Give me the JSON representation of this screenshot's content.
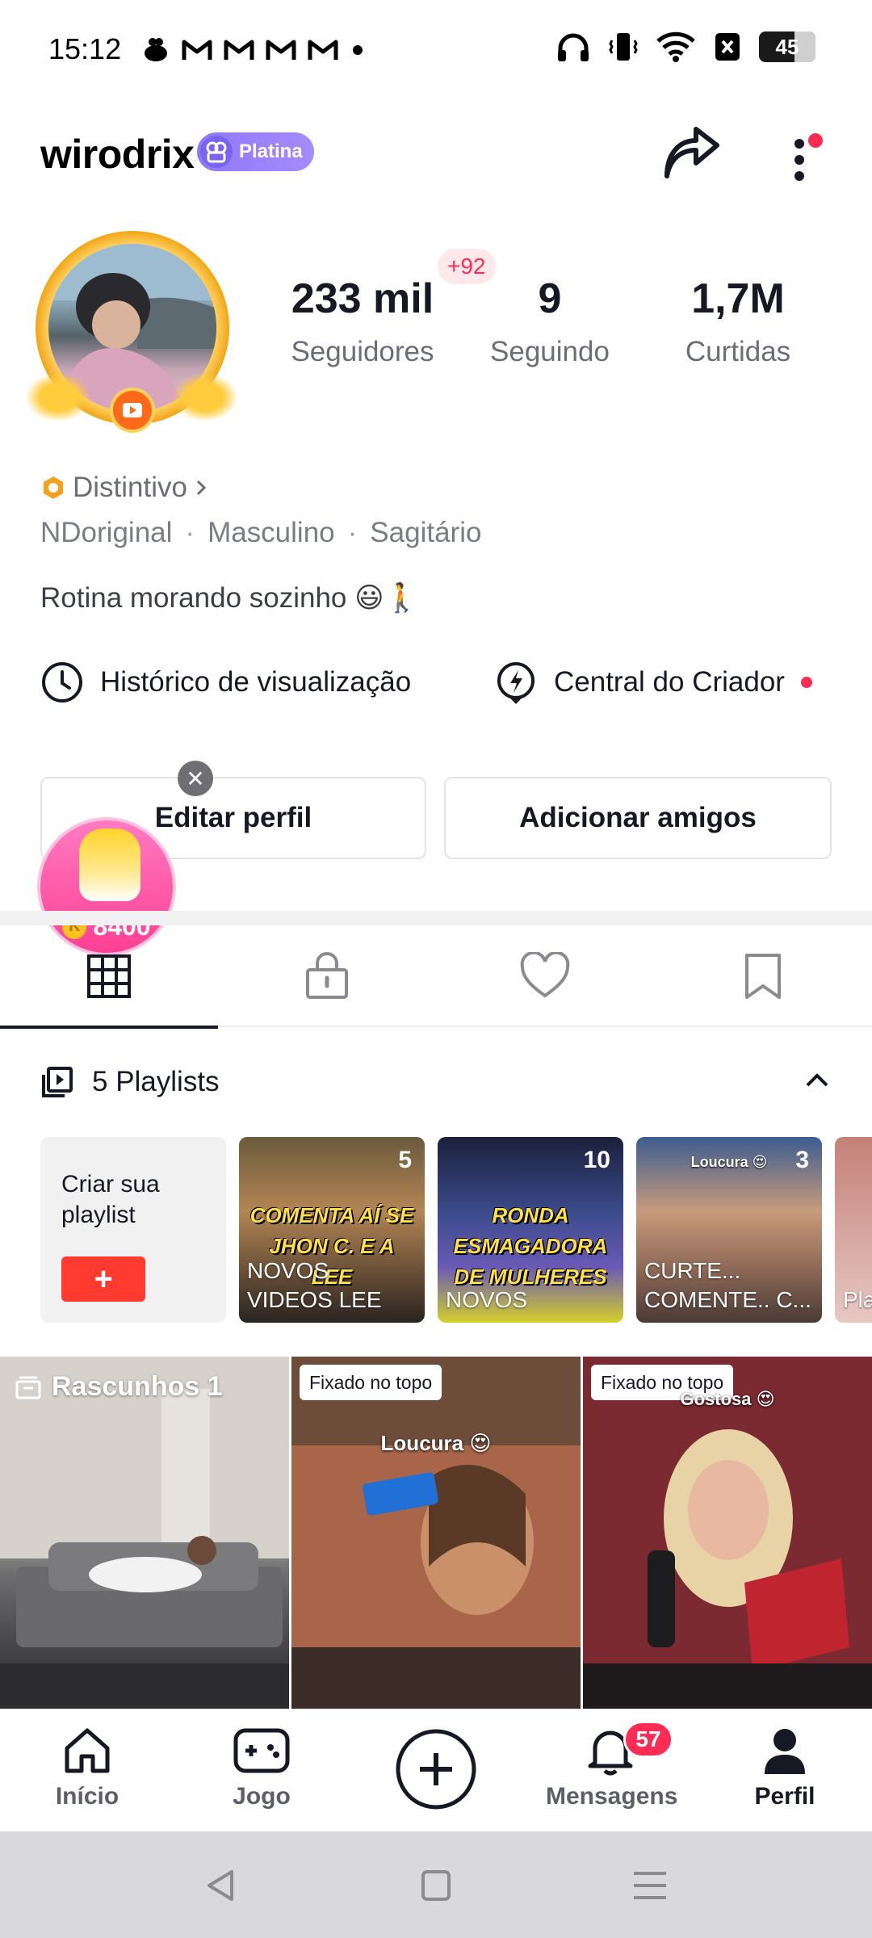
{
  "status_bar": {
    "time": "15:12",
    "battery": "45",
    "notification_icons": [
      "chef-icon",
      "gmail-icon",
      "gmail-icon",
      "gmail-icon",
      "gmail-icon",
      "dot-icon"
    ],
    "system_icons": [
      "headphones-icon",
      "vibrate-icon",
      "wifi-icon",
      "sim-off-icon",
      "battery-icon"
    ]
  },
  "header": {
    "username": "wirodrix",
    "tier_badge": "Platina"
  },
  "profile": {
    "stats": [
      {
        "value": "233 mil",
        "label": "Seguidores"
      },
      {
        "value": "9",
        "label": "Seguindo"
      },
      {
        "value": "1,7M",
        "label": "Curtidas"
      }
    ],
    "new_followers": "+92",
    "distintivo": "Distintivo",
    "meta": [
      "NDoriginal",
      "Masculino",
      "Sagitário"
    ],
    "bio": "Rotina morando sozinho 😃🚶",
    "shortcuts": {
      "history": "Histórico de visualização",
      "creator": "Central do Criador"
    },
    "buttons": {
      "edit": "Editar perfil",
      "add_friends": "Adicionar amigos"
    },
    "coins": "8400"
  },
  "tabs": [
    "grid-icon",
    "lock-icon",
    "heart-icon",
    "bookmark-icon"
  ],
  "playlists": {
    "header": "5 Playlists",
    "create_label": "Criar sua playlist",
    "items": [
      {
        "count": "5",
        "name": "NOVOS VIDEOS LEE",
        "caption": "COMENTA AÍ SE JHON C. E A LEE"
      },
      {
        "count": "10",
        "name": "NOVOS",
        "caption": "RONDA ESMAGADORA DE MULHERES"
      },
      {
        "count": "3",
        "name": "CURTE... COMENTE.. C...",
        "caption": "Loucura 😍"
      },
      {
        "count": "",
        "name": "Pla",
        "caption": ""
      }
    ]
  },
  "videos": [
    {
      "label": "Rascunhos 1",
      "pinned": "",
      "caption": ""
    },
    {
      "label": "",
      "pinned": "Fixado no topo",
      "caption": "Loucura 😍"
    },
    {
      "label": "",
      "pinned": "Fixado no topo",
      "caption": "Gostosa 😍"
    }
  ],
  "bottom_nav": {
    "home": "Início",
    "game": "Jogo",
    "messages": "Mensagens",
    "messages_badge": "57",
    "profile": "Perfil"
  },
  "colors": {
    "accent": "#fe2c55",
    "platina": "#8e78f5",
    "text": "#161823",
    "muted": "#6b6e76"
  }
}
